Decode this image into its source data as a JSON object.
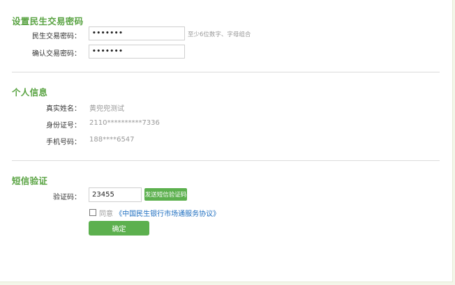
{
  "password_section": {
    "title": "设置民生交易密码",
    "password_label": "民生交易密码：",
    "password_value": "•••••••",
    "password_hint": "至少6位数字、字母组合",
    "confirm_label": "确认交易密码：",
    "confirm_value": "•••••••"
  },
  "personal_section": {
    "title": "个人信息",
    "name_label": "真实姓名：",
    "name_value": "黄兜兜测试",
    "id_label": "身份证号：",
    "id_value": "2110**********7336",
    "phone_label": "手机号码：",
    "phone_value": "188****6547"
  },
  "sms_section": {
    "title": "短信验证",
    "code_label": "验证码：",
    "code_value": "23455",
    "send_button": "发送短信验证码",
    "agree_text": "同意",
    "agreement_link": "《中国民生银行市场通服务协议》",
    "confirm_button": "确定"
  },
  "colors": {
    "accent_green": "#59a342",
    "button_green": "#5cb04e",
    "link_blue": "#1f6fc0"
  }
}
